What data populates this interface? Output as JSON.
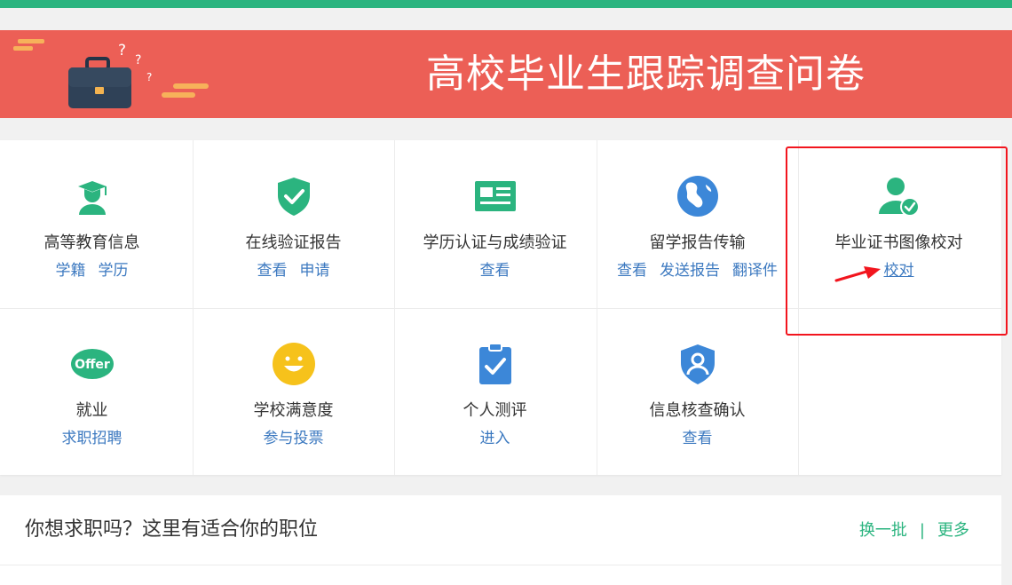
{
  "banner": {
    "title": "高校毕业生跟踪调查问卷"
  },
  "services": [
    {
      "title": "高等教育信息",
      "icon": "graduate-icon",
      "links": [
        "学籍",
        "学历"
      ]
    },
    {
      "title": "在线验证报告",
      "icon": "shield-check-icon",
      "links": [
        "查看",
        "申请"
      ]
    },
    {
      "title": "学历认证与成绩验证",
      "icon": "id-card-icon",
      "links": [
        "查看"
      ]
    },
    {
      "title": "留学报告传输",
      "icon": "globe-icon",
      "links": [
        "查看",
        "发送报告",
        "翻译件"
      ]
    },
    {
      "title": "毕业证书图像校对",
      "icon": "user-check-icon",
      "links": [
        "校对"
      ]
    },
    {
      "title": "就业",
      "icon": "offer-icon",
      "links": [
        "求职招聘"
      ],
      "icon_text": "Offer"
    },
    {
      "title": "学校满意度",
      "icon": "smiley-icon",
      "links": [
        "参与投票"
      ]
    },
    {
      "title": "个人测评",
      "icon": "clipboard-check-icon",
      "links": [
        "进入"
      ]
    },
    {
      "title": "信息核查确认",
      "icon": "user-shield-icon",
      "links": [
        "查看"
      ]
    }
  ],
  "jobs_section": {
    "title": "你想求职吗？这里有适合你的职位",
    "refresh_label": "换一批",
    "separator": "|",
    "more_label": "更多"
  },
  "colors": {
    "brand_green": "#2bb47f",
    "banner_red": "#ec5f56",
    "link_blue": "#3c79c0",
    "highlight_red": "#f2151e"
  }
}
